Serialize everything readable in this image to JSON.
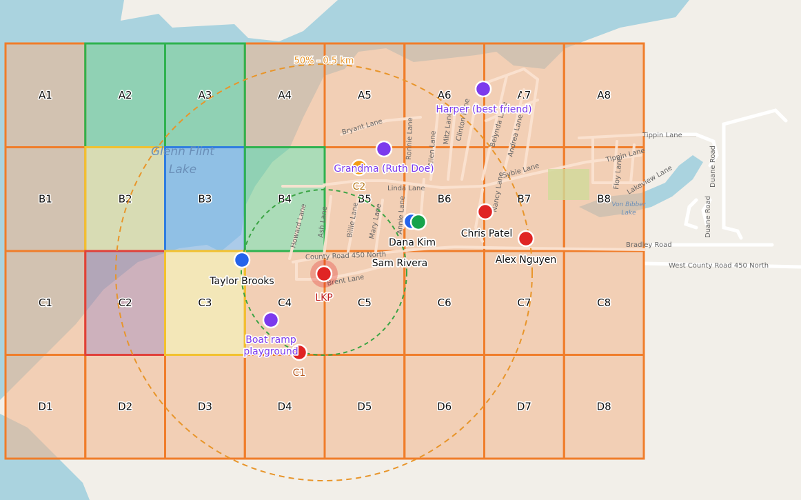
{
  "map": {
    "colors": {
      "land": "#f2efe9",
      "water": "#aad3df",
      "grid_fill": "#f3b48a",
      "grid_stroke": "#f07d2a",
      "ring_color": "#e8952a",
      "inner_ring_color": "#3ba444"
    },
    "lake_labels": [
      "Glenn Flint",
      "Lake",
      "Von Bibber",
      "Lake"
    ],
    "streets": [
      "Bryant Lane",
      "Linda Lane",
      "Tippin Lane",
      "Tippin Lane",
      "Sybie Lane",
      "Lakeview Lane",
      "Bradley Road",
      "West County Road 450 North",
      "County Road 450 North",
      "Brent Lane",
      "Howard Lane",
      "Billie Lane",
      "Mary Lane",
      "Ronnie Lane",
      "Allen Lane",
      "Mitz Lane",
      "Clinton Lane",
      "Belynda Lane",
      "Andrea Lane",
      "Nancy Lane",
      "Floy Lane",
      "Duane Road",
      "Duane Road",
      "Ash Lane",
      "Annie Lane"
    ],
    "ring_label": "50% - 0.5 km",
    "grid": {
      "rows": [
        "A",
        "B",
        "C",
        "D"
      ],
      "cols": [
        "1",
        "2",
        "3",
        "4",
        "5",
        "6",
        "7",
        "8"
      ],
      "cells": [
        [
          "A1",
          "A2",
          "A3",
          "A4",
          "A5",
          "A6",
          "A7",
          "A8"
        ],
        [
          "B1",
          "B2",
          "B3",
          "B4",
          "B5",
          "B6",
          "B7",
          "B8"
        ],
        [
          "C1",
          "C2",
          "C3",
          "C4",
          "C5",
          "C6",
          "C7",
          "C8"
        ],
        [
          "D1",
          "D2",
          "D3",
          "D4",
          "D5",
          "D6",
          "D7",
          "D8"
        ]
      ],
      "status": {
        "A2": "green",
        "A3": "green",
        "B4": "green",
        "B2": "yellow",
        "C3": "yellow",
        "B3": "blue",
        "C2": "red"
      }
    },
    "markers": [
      {
        "id": "lkp",
        "label": "LKP",
        "color": "#e02424",
        "kind": "lkp"
      },
      {
        "id": "c1",
        "label": "C1",
        "color": "#e02424",
        "kind": "clue"
      },
      {
        "id": "c2",
        "label": "C2",
        "color": "#f39c12",
        "kind": "clue"
      },
      {
        "id": "harper",
        "label": "Harper (best friend)",
        "color": "#7c3aed",
        "kind": "poi"
      },
      {
        "id": "grandma",
        "label": "Grandma (Ruth Doe)",
        "color": "#7c3aed",
        "kind": "poi"
      },
      {
        "id": "boatramp",
        "label": "Boat ramp playground",
        "color": "#7c3aed",
        "kind": "poi"
      },
      {
        "id": "taylor",
        "label": "Taylor Brooks",
        "color": "#2563eb",
        "kind": "team"
      },
      {
        "id": "dana",
        "label": "Dana Kim",
        "color": "#2563eb",
        "kind": "team"
      },
      {
        "id": "sam",
        "label": "Sam Rivera",
        "color": "#16a34a",
        "kind": "team"
      },
      {
        "id": "chris",
        "label": "Chris Patel",
        "color": "#e02424",
        "kind": "team"
      },
      {
        "id": "alex",
        "label": "Alex Nguyen",
        "color": "#e02424",
        "kind": "team"
      }
    ]
  }
}
